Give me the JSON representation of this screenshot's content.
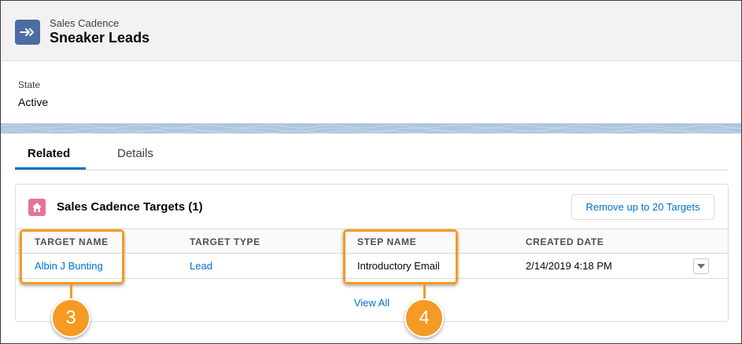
{
  "header": {
    "eyebrow": "Sales Cadence",
    "title": "Sneaker Leads",
    "icon": "cadence-arrow-icon",
    "icon_color": "#4a6ea3"
  },
  "details": {
    "state_label": "State",
    "state_value": "Active"
  },
  "tabs": [
    {
      "label": "Related",
      "active": true
    },
    {
      "label": "Details",
      "active": false
    }
  ],
  "card": {
    "title": "Sales Cadence Targets (1)",
    "icon": "home-icon",
    "icon_color": "#e3739c",
    "action_button": "Remove up to 20 Targets",
    "columns": [
      "TARGET NAME",
      "TARGET TYPE",
      "STEP NAME",
      "CREATED DATE"
    ],
    "rows": [
      {
        "target_name": "Albin J Bunting",
        "target_type": "Lead",
        "step_name": "Introductory Email",
        "created_date": "2/14/2019 4:18 PM"
      }
    ],
    "view_all": "View All"
  },
  "callouts": [
    {
      "number": "3"
    },
    {
      "number": "4"
    }
  ],
  "colors": {
    "accent": "#0070d2",
    "callout": "#f59a23"
  }
}
